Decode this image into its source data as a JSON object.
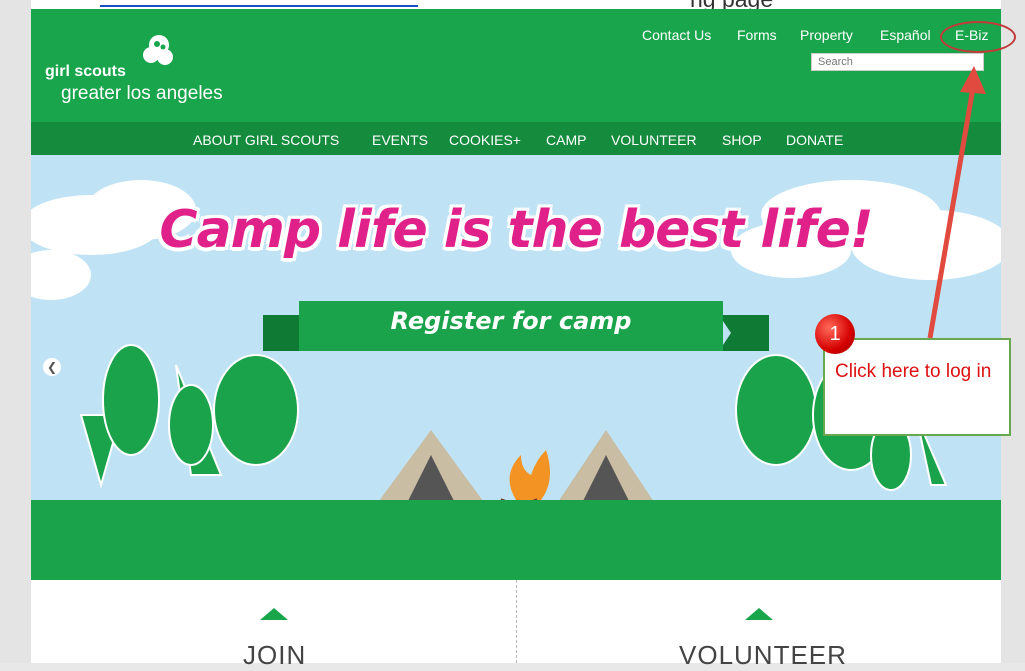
{
  "page": {
    "top_text_fragment": "ng page"
  },
  "header": {
    "logo_line1": "girl scouts",
    "logo_line2": "greater los angeles",
    "utility_links": [
      "Contact Us",
      "Forms",
      "Property",
      "Español",
      "E-Biz"
    ],
    "search_placeholder": "Search"
  },
  "nav": {
    "items": [
      "ABOUT GIRL SCOUTS",
      "EVENTS",
      "COOKIES+",
      "CAMP",
      "VOLUNTEER",
      "SHOP",
      "DONATE"
    ]
  },
  "hero": {
    "headline": "Camp life is the best life!",
    "cta": "Register for camp",
    "prev_icon": "chevron-left-icon"
  },
  "cards": [
    {
      "title": "JOIN"
    },
    {
      "title": "VOLUNTEER"
    }
  ],
  "annotation": {
    "badge": "1",
    "text": "Click here to log in"
  },
  "colors": {
    "brand_green": "#19a54b",
    "nav_green": "#158b3e",
    "headline_pink": "#e0218a",
    "annotation_red": "#d11"
  }
}
